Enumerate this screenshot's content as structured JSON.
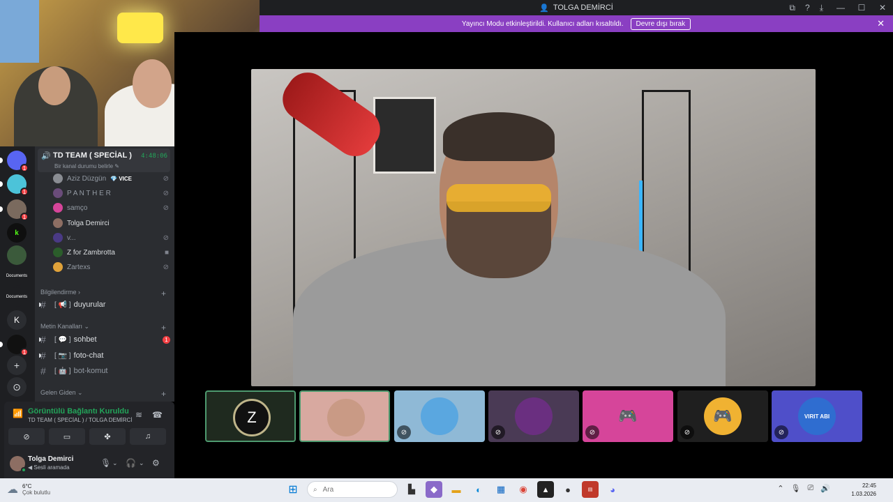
{
  "window": {
    "title": "TOLGA DEMİRCİ",
    "controls": [
      "—",
      "☐",
      "✕"
    ],
    "toolbar_icons": [
      "screen-share-icon",
      "help-icon",
      "download-icon"
    ]
  },
  "streamer_mode": {
    "message": "Yayıncı Modu etkinleştirildi. Kullanıcı adları kısaltıldı.",
    "disable_label": "Devre dışı bırak",
    "close": "✕"
  },
  "servers": [
    {
      "badge": "1"
    },
    {
      "badge": "1"
    },
    {
      "badge": "1"
    },
    {
      "badge": ""
    },
    {
      "badge": ""
    },
    {
      "label": "Documents"
    },
    {
      "label": "Documents"
    },
    {
      "label": "K"
    },
    {
      "badge": "1"
    },
    {
      "label": "+"
    },
    {
      "label": "⊙"
    }
  ],
  "voice_channel": {
    "name": "TD TEAM ( SPECİAL )",
    "status": "Bir kanal durumu belirle ✎",
    "timer": "4:48:06",
    "members": [
      {
        "name": "Aziz Düzgün",
        "tag": "💎 VICE",
        "muted": true
      },
      {
        "name": "P A N T H E R",
        "muted": true
      },
      {
        "name": "samço",
        "muted": true
      },
      {
        "name": "Tolga Demirci",
        "muted": false
      },
      {
        "name": "v...",
        "muted": true
      },
      {
        "name": "Z for Zambrotta",
        "video": true
      },
      {
        "name": "Zartexs",
        "muted": true
      }
    ]
  },
  "categories": {
    "info": "Bilgilendirme ›",
    "text": "Metin Kanalları ⌄",
    "inout": "Gelen Giden ⌄"
  },
  "channels": {
    "duyurular": {
      "icon": "[ 📢 ]",
      "name": "duyurular"
    },
    "sohbet": {
      "icon": "[ 💬 ]",
      "name": "sohbet",
      "unread": "1"
    },
    "foto": {
      "icon": "[ 📷 ]",
      "name": "foto-chat"
    },
    "bot": {
      "icon": "[ 🤖 ]",
      "name": "bot-komut"
    }
  },
  "voice_panel": {
    "status": "Görüntülü Bağlantı Kuruldu",
    "sub": "TD TEAM ( SPECİAL ) / TOLGA DEMİRCİ"
  },
  "user": {
    "name": "Tolga Demirci",
    "status": "◀ Sesli aramada"
  },
  "tiles": [
    {
      "label": "Z",
      "color": "#1f2a1f"
    },
    {
      "label": "",
      "color": "#d8a9a0"
    },
    {
      "label": "",
      "color": "#8fb9d6"
    },
    {
      "label": "",
      "color": "#4a3a55"
    },
    {
      "label": "",
      "color": "#d6459a"
    },
    {
      "label": "",
      "color": "#1f1f1f"
    },
    {
      "label": "VIRIT ABI",
      "color": "#4f4fc9"
    }
  ],
  "taskbar": {
    "temp": "6°C",
    "weather": "Çok bulutlu",
    "search_placeholder": "Ara",
    "time": "22:45",
    "date": "1.03.2026"
  }
}
